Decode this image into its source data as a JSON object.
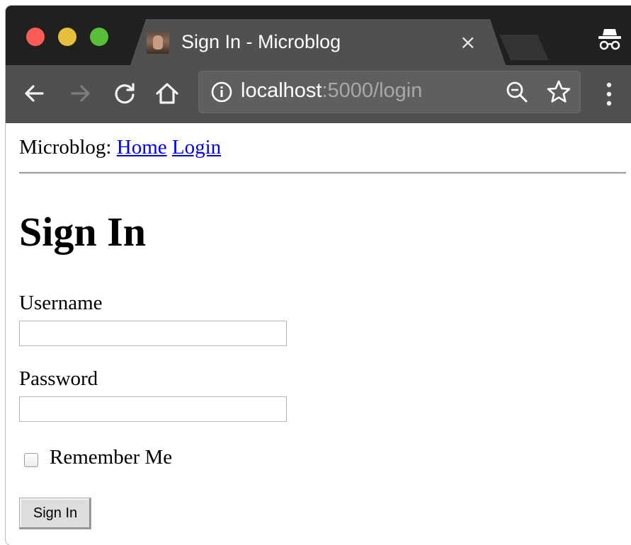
{
  "browser": {
    "tab": {
      "title": "Sign In - Microblog",
      "close_glyph": "×"
    },
    "toolbar": {
      "url_host": "localhost",
      "url_rest": ":5000/login"
    },
    "icons": {
      "back": "arrow-left-icon",
      "forward": "arrow-right-icon",
      "reload": "reload-icon",
      "home": "home-icon",
      "info": "info-icon",
      "zoom": "zoom-icon",
      "star": "star-icon",
      "menu": "menu-icon",
      "incognito": "incognito-icon"
    },
    "colors": {
      "tabstrip": "#202020",
      "toolbar": "#505050",
      "traffic_close": "#fc5b57",
      "traffic_min": "#e5bf3c",
      "traffic_max": "#57c038"
    }
  },
  "page": {
    "nav": {
      "prefix": "Microblog:",
      "home": "Home",
      "login": "Login"
    },
    "heading": "Sign In",
    "form": {
      "username_label": "Username",
      "username_value": "",
      "password_label": "Password",
      "password_value": "",
      "remember_label": "Remember Me",
      "submit_label": "Sign In"
    },
    "colors": {
      "link": "#0000ee"
    }
  }
}
